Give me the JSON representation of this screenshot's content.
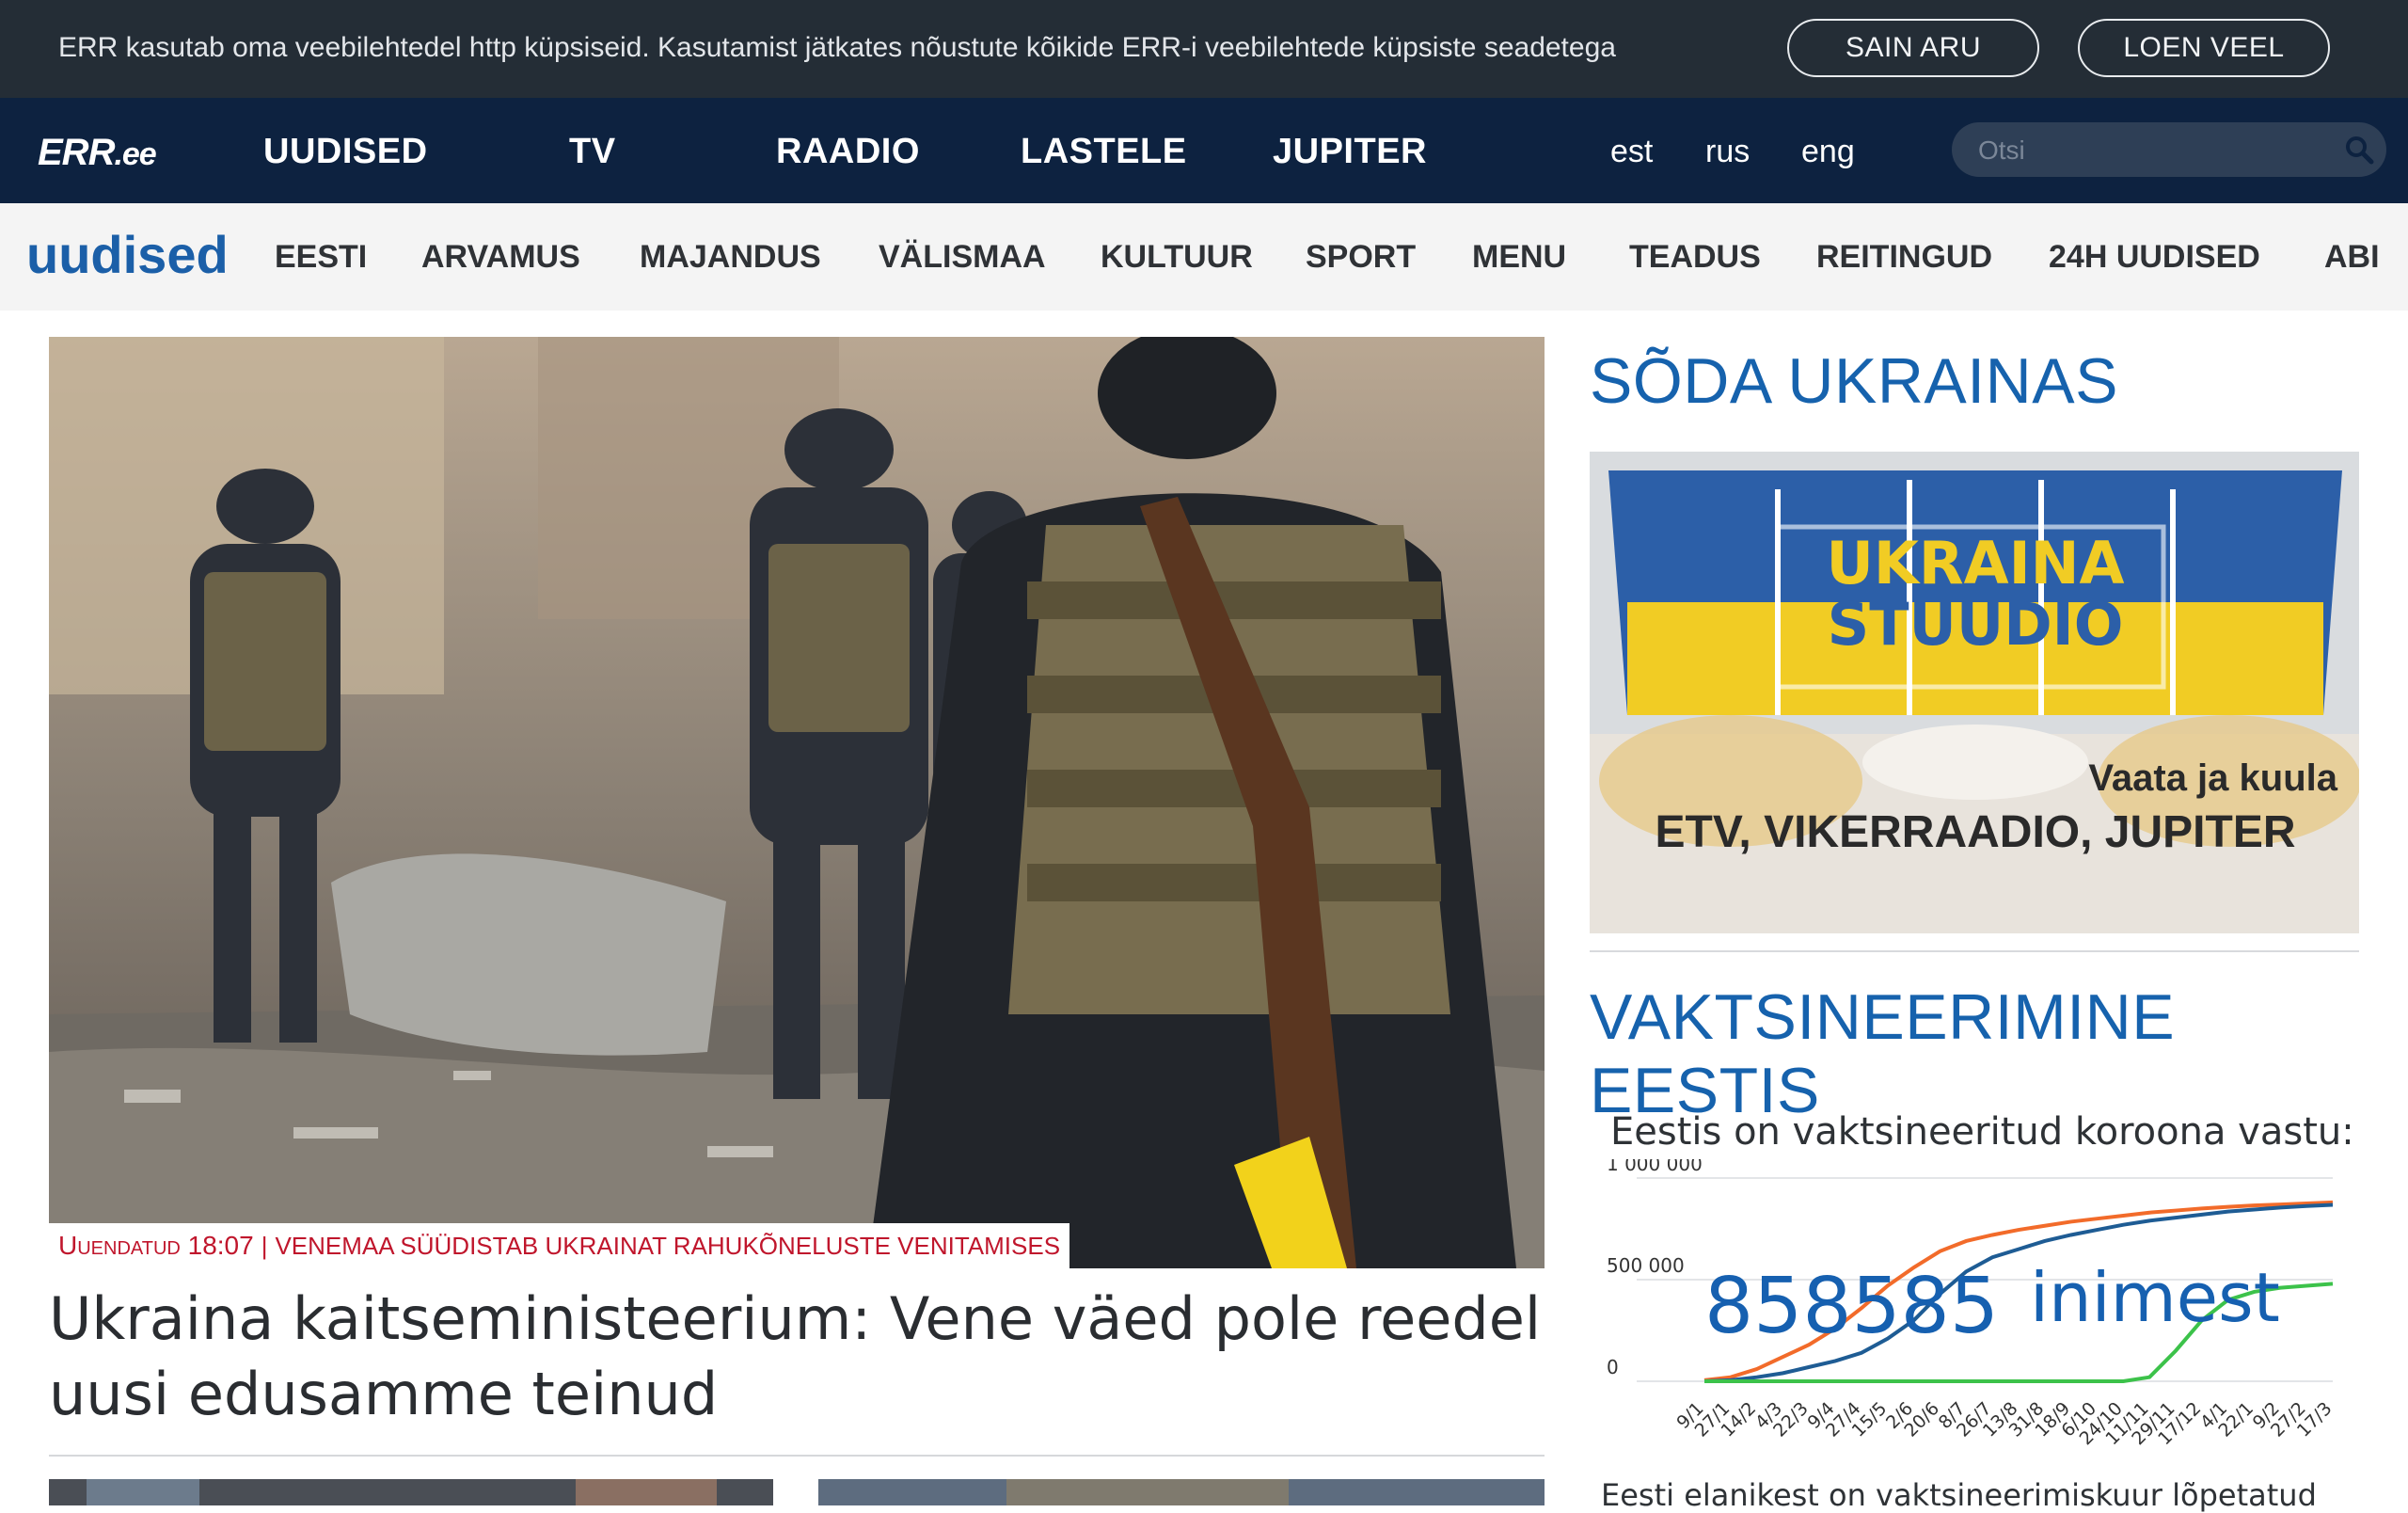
{
  "cookie": {
    "text": "ERR kasutab oma veebilehtedel http küpsiseid. Kasutamist jätkates nõustute kõikide ERR-i veebilehtede küpsiste seadetega",
    "agree_label": "SAIN ARU",
    "more_label": "LOEN VEEL"
  },
  "topnav": {
    "logo": "ERR",
    "logo_suffix": ".ee",
    "items": [
      "UUDISED",
      "TV",
      "RAADIO",
      "LASTELE",
      "JUPITER"
    ],
    "languages": [
      "est",
      "rus",
      "eng"
    ],
    "search_placeholder": "Otsi"
  },
  "subnav": {
    "brand": "uudised",
    "items": [
      "EESTI",
      "ARVAMUS",
      "MAJANDUS",
      "VÄLISMAA",
      "KULTUUR",
      "SPORT",
      "MENU",
      "TEADUS",
      "REITINGUD",
      "24H UUDISED",
      "ABI"
    ]
  },
  "main": {
    "caption_updated": "Uuendatud 18:07",
    "caption_separator": "|",
    "caption_topic": "VENEMAA SÜÜDISTAB UKRAINAT RAHUKÕNELUSTE VENITAMISES",
    "headline": "Ukraina kaitseministeerium: Vene väed pole reedel uusi edusamme teinud"
  },
  "sidebar": {
    "war_title": "SÕDA UKRAINAS",
    "promo": {
      "line1": "UKRAINA",
      "line2": "STUUDIO",
      "tagline": "Vaata ja kuula",
      "channels": "ETV, VIKERRAADIO, JUPITER"
    },
    "vaccination_title": "VAKTSINEERIMINE EESTIS",
    "vaccination_text": "Eestis on vaktsineeritud koroona vastu:",
    "big_number": "858585",
    "big_unit": "inimest",
    "footer_text": "Eesti elanikest on vaktsineerimiskuur lõpetatud"
  },
  "colors": {
    "cookie_bg": "#242d36",
    "topnav_bg": "#0d2240",
    "brand_blue": "#1b5fa8",
    "caption_red": "#c0162c",
    "series_orange": "#f26b2a",
    "series_blue": "#1e5c94",
    "series_green": "#3cc24a"
  },
  "chart_data": {
    "type": "line",
    "ylim": [
      0,
      1000000
    ],
    "yticks": [
      "1 000 000",
      "500 000",
      "0"
    ],
    "x": [
      "9/1",
      "27/1",
      "14/2",
      "4/3",
      "22/3",
      "9/4",
      "27/4",
      "15/5",
      "2/6",
      "20/6",
      "8/7",
      "26/7",
      "13/8",
      "31/8",
      "18/9",
      "6/10",
      "24/10",
      "11/11",
      "29/11",
      "17/12",
      "4/1",
      "22/1",
      "9/2",
      "27/2",
      "17/3"
    ],
    "series": [
      {
        "color": "#f26b2a",
        "values": [
          5000,
          20000,
          60000,
          120000,
          180000,
          260000,
          360000,
          470000,
          560000,
          640000,
          690000,
          720000,
          745000,
          765000,
          785000,
          800000,
          815000,
          830000,
          840000,
          850000,
          858000,
          865000,
          870000,
          875000,
          880000
        ]
      },
      {
        "color": "#1e5c94",
        "values": [
          0,
          5000,
          20000,
          40000,
          70000,
          100000,
          140000,
          210000,
          300000,
          430000,
          540000,
          610000,
          650000,
          690000,
          720000,
          745000,
          770000,
          790000,
          805000,
          820000,
          835000,
          845000,
          855000,
          862000,
          868000
        ]
      },
      {
        "color": "#3cc24a",
        "values": [
          0,
          0,
          0,
          0,
          0,
          0,
          0,
          0,
          0,
          0,
          0,
          0,
          0,
          0,
          0,
          0,
          0,
          20000,
          150000,
          300000,
          400000,
          440000,
          460000,
          470000,
          480000
        ]
      }
    ]
  }
}
